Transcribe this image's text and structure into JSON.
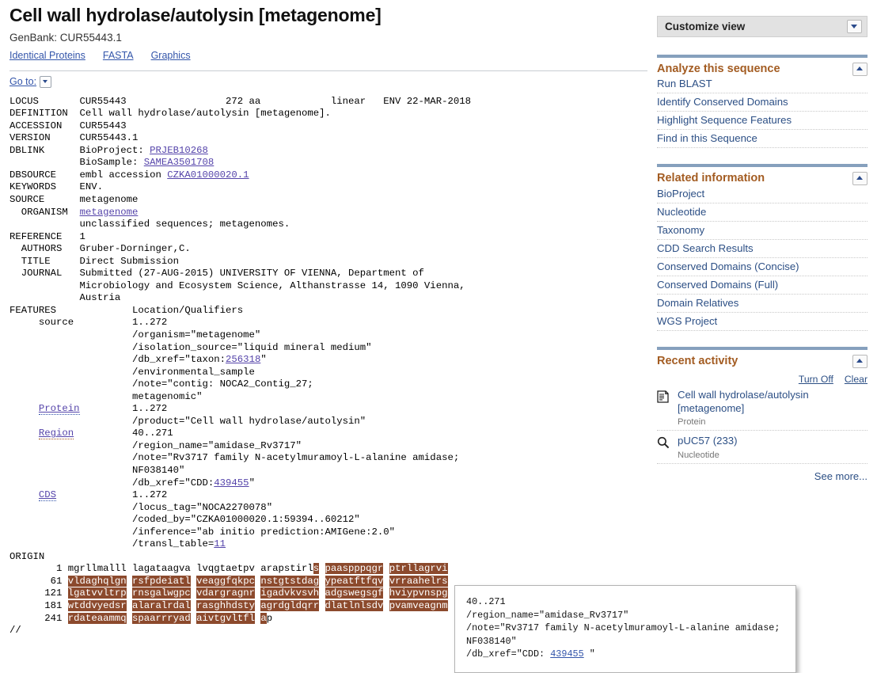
{
  "header": {
    "title": "Cell wall hydrolase/autolysin [metagenome]",
    "accession_line": "GenBank: CUR55443.1",
    "links": [
      {
        "label": "Identical Proteins"
      },
      {
        "label": "FASTA"
      },
      {
        "label": "Graphics"
      }
    ],
    "goto_label": "Go to:"
  },
  "genbank": {
    "lines": [
      {
        "text": "LOCUS       CUR55443                 272 aa            linear   ENV 22-MAR-2018"
      },
      {
        "text": "DEFINITION  Cell wall hydrolase/autolysin [metagenome]."
      },
      {
        "text": "ACCESSION   CUR55443"
      },
      {
        "text": "VERSION     CUR55443.1"
      },
      {
        "text": "DBLINK      BioProject: ",
        "link": "PRJEB10268"
      },
      {
        "text": "            BioSample: ",
        "link": "SAMEA3501708"
      },
      {
        "text": "DBSOURCE    embl accession ",
        "link": "CZKA01000020.1"
      },
      {
        "text": "KEYWORDS    ENV."
      },
      {
        "text": "SOURCE      metagenome"
      },
      {
        "text": "  ORGANISM  ",
        "link": "metagenome"
      },
      {
        "text": "            unclassified sequences; metagenomes."
      },
      {
        "text": "REFERENCE   1"
      },
      {
        "text": "  AUTHORS   Gruber-Dorninger,C."
      },
      {
        "text": "  TITLE     Direct Submission"
      },
      {
        "text": "  JOURNAL   Submitted (27-AUG-2015) UNIVERSITY OF VIENNA, Department of"
      },
      {
        "text": "            Microbiology and Ecosystem Science, Althanstrasse 14, 1090 Vienna,"
      },
      {
        "text": "            Austria"
      },
      {
        "text": "FEATURES             Location/Qualifiers"
      },
      {
        "text": "     source          1..272"
      },
      {
        "text": "                     /organism=\"metagenome\""
      },
      {
        "text": "                     /isolation_source=\"liquid mineral medium\""
      },
      {
        "text": "                     /db_xref=\"taxon:",
        "link": "256318",
        "suffix": "\""
      },
      {
        "text": "                     /environmental_sample"
      },
      {
        "text": "                     /note=\"contig: NOCA2_Contig_27;"
      },
      {
        "text": "                     metagenomic\""
      },
      {
        "text": "     ",
        "feature_key": "Protein",
        "after_key": "         1..272"
      },
      {
        "text": "                     /product=\"Cell wall hydrolase/autolysin\""
      },
      {
        "text": "     ",
        "feature_key_hover": "Region",
        "after_key": "          40..271"
      },
      {
        "text": "                     /region_name=\"amidase_Rv3717\""
      },
      {
        "text": "                     /note=\"Rv3717 family N-acetylmuramoyl-L-alanine amidase;"
      },
      {
        "text": "                     NF038140\""
      },
      {
        "text": "                     /db_xref=\"CDD:",
        "link": "439455",
        "suffix": "\""
      },
      {
        "text": "     ",
        "feature_key": "CDS",
        "after_key": "             1..272"
      },
      {
        "text": "                     /locus_tag=\"NOCA2270078\""
      },
      {
        "text": "                     /coded_by=\"CZKA01000020.1:59394..60212\""
      },
      {
        "text": "                     /inference=\"ab initio prediction:AMIGene:2.0\""
      },
      {
        "text": "                     /transl_table=",
        "link": "11"
      },
      {
        "text": "ORIGIN      "
      }
    ],
    "sequence": {
      "highlight_start": 40,
      "highlight_end": 271,
      "rows": [
        {
          "num": "1",
          "blocks": [
            "mgrllmalll",
            "lagataagva",
            "lvqgtaetpv",
            "arapstirls",
            "paaspppqgr",
            "ptrllagrvi"
          ]
        },
        {
          "num": "61",
          "blocks": [
            "vldaghqlgn",
            "rsfpdeiatl",
            "veaggfqkpc",
            "nstgtstdag",
            "ypeatftfqv",
            "vrraahelrs"
          ]
        },
        {
          "num": "121",
          "blocks": [
            "lgatvvltrp",
            "rnsgalwgpc",
            "vdargragnr",
            "igadvkvsvh",
            "adgswegsgf",
            "hviypvnspg"
          ]
        },
        {
          "num": "181",
          "blocks": [
            "wtddvyedsr",
            "alaralrdal",
            "rasghhdsty",
            "agrdgldqrr",
            "dlatlnlsdv",
            "pvamveagnm"
          ]
        },
        {
          "num": "241",
          "blocks": [
            "rdateaammq",
            "spaarrryad",
            "aivtgvltfl",
            "ap"
          ]
        }
      ]
    },
    "terminator": "//"
  },
  "tooltip": {
    "line1": "40..271",
    "line2": "/region_name=\"amidase_Rv3717\"",
    "line3": "/note=\"Rv3717 family N-acetylmuramoyl-L-alanine amidase;",
    "line4": "NF038140\"",
    "line5_prefix": "/db_xref=\"CDD: ",
    "line5_link": "439455",
    "line5_suffix": " \""
  },
  "sidebar": {
    "customize_view": "Customize view",
    "analyze": {
      "title": "Analyze this sequence",
      "items": [
        {
          "label": "Run BLAST"
        },
        {
          "label": "Identify Conserved Domains"
        },
        {
          "label": "Highlight Sequence Features"
        },
        {
          "label": "Find in this Sequence"
        }
      ]
    },
    "related": {
      "title": "Related information",
      "items": [
        {
          "label": "BioProject"
        },
        {
          "label": "Nucleotide"
        },
        {
          "label": "Taxonomy"
        },
        {
          "label": "CDD Search Results"
        },
        {
          "label": "Conserved Domains (Concise)"
        },
        {
          "label": "Conserved Domains (Full)"
        },
        {
          "label": "Domain Relatives"
        },
        {
          "label": "WGS Project"
        }
      ]
    },
    "recent_activity": {
      "title": "Recent activity",
      "turn_off": "Turn Off",
      "clear": "Clear",
      "items": [
        {
          "title": "Cell wall hydrolase/autolysin [metagenome]",
          "db": "Protein",
          "icon": "document-icon"
        },
        {
          "title": "pUC57 (233)",
          "db": "Nucleotide",
          "icon": "search-icon"
        }
      ],
      "see_more": "See more..."
    }
  },
  "colors": {
    "link": "#2c4f85",
    "panel_heading": "#a35c22",
    "sequence_highlight": "#8c4a2d",
    "panel_topbar": "#86a0bd"
  }
}
